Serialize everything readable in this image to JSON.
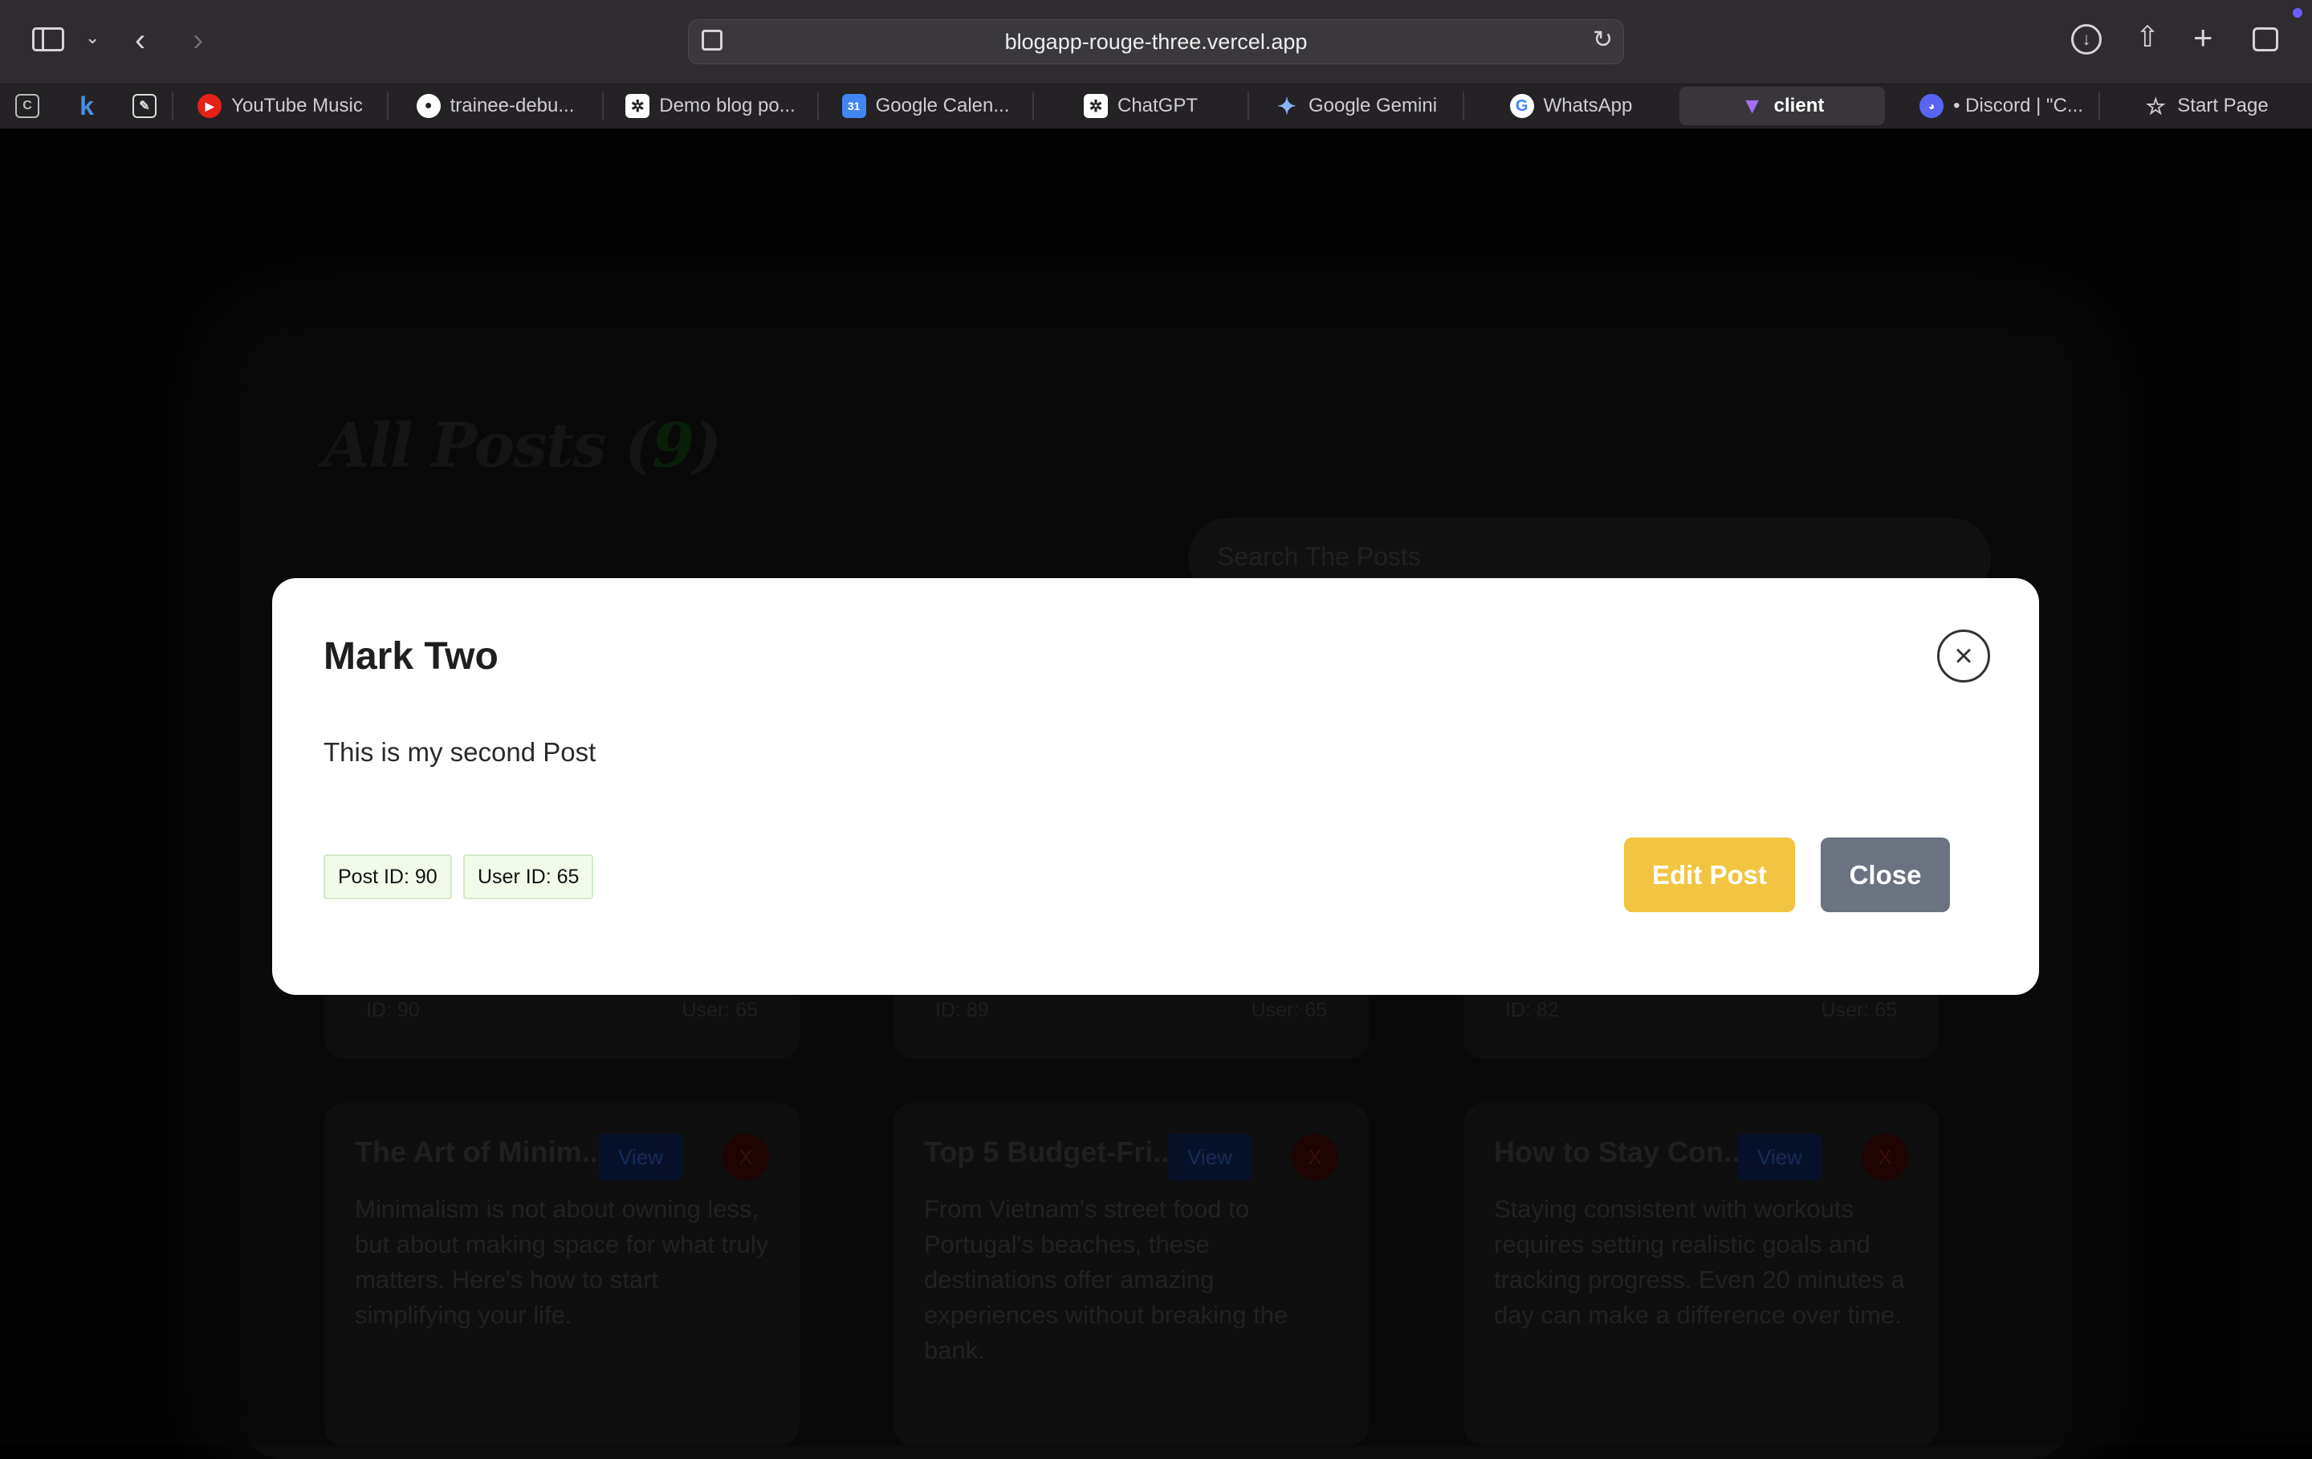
{
  "browser": {
    "url": "blogapp-rouge-three.vercel.app",
    "tabs": [
      {
        "label": "YouTube Music",
        "icon": "youtube-music-icon",
        "color": "#e62117"
      },
      {
        "label": "trainee-debu...",
        "icon": "github-icon",
        "color": "#ffffff"
      },
      {
        "label": "Demo blog po...",
        "icon": "chatgpt-icon",
        "color": "#ffffff"
      },
      {
        "label": "Google Calen...",
        "icon": "google-calendar-icon",
        "color": "#4285f4"
      },
      {
        "label": "ChatGPT",
        "icon": "chatgpt-icon",
        "color": "#ffffff"
      },
      {
        "label": "Google Gemini",
        "icon": "gemini-icon",
        "color": "#8ab4f8"
      },
      {
        "label": "WhatsApp",
        "icon": "google-icon",
        "color": "#ffffff"
      },
      {
        "label": "client",
        "icon": "vite-icon",
        "color": "#a56cff"
      },
      {
        "label": "• Discord | \"C...",
        "icon": "discord-icon",
        "color": "#5865f2"
      },
      {
        "label": "Start Page",
        "icon": "star-icon",
        "color": "#cfcdd2"
      }
    ],
    "pinned": [
      "k"
    ]
  },
  "page": {
    "title": "All Posts",
    "count": "9",
    "search_placeholder": "Search The Posts",
    "view_label": "View",
    "delete_label": "X",
    "top_row_footers": [
      {
        "id": "ID: 90",
        "user": "User: 65"
      },
      {
        "id": "ID: 89",
        "user": "User: 65"
      },
      {
        "id": "ID: 82",
        "user": "User: 65"
      }
    ],
    "cards": [
      {
        "title": "The Art of Minim...",
        "body": "Minimalism is not about owning less, but about making space for what truly matters. Here's how to start simplifying your life."
      },
      {
        "title": "Top 5 Budget-Fri...",
        "body": "From Vietnam's street food to Portugal's beaches, these destinations offer amazing experiences without breaking the bank."
      },
      {
        "title": "How to Stay Con...",
        "body": "Staying consistent with workouts requires setting realistic goals and tracking progress. Even 20 minutes a day can make a difference over time."
      }
    ]
  },
  "modal": {
    "title": "Mark Two",
    "body": "This is my second Post",
    "post_id": "Post ID: 90",
    "user_id": "User ID: 65",
    "edit_label": "Edit Post",
    "close_label": "Close"
  }
}
